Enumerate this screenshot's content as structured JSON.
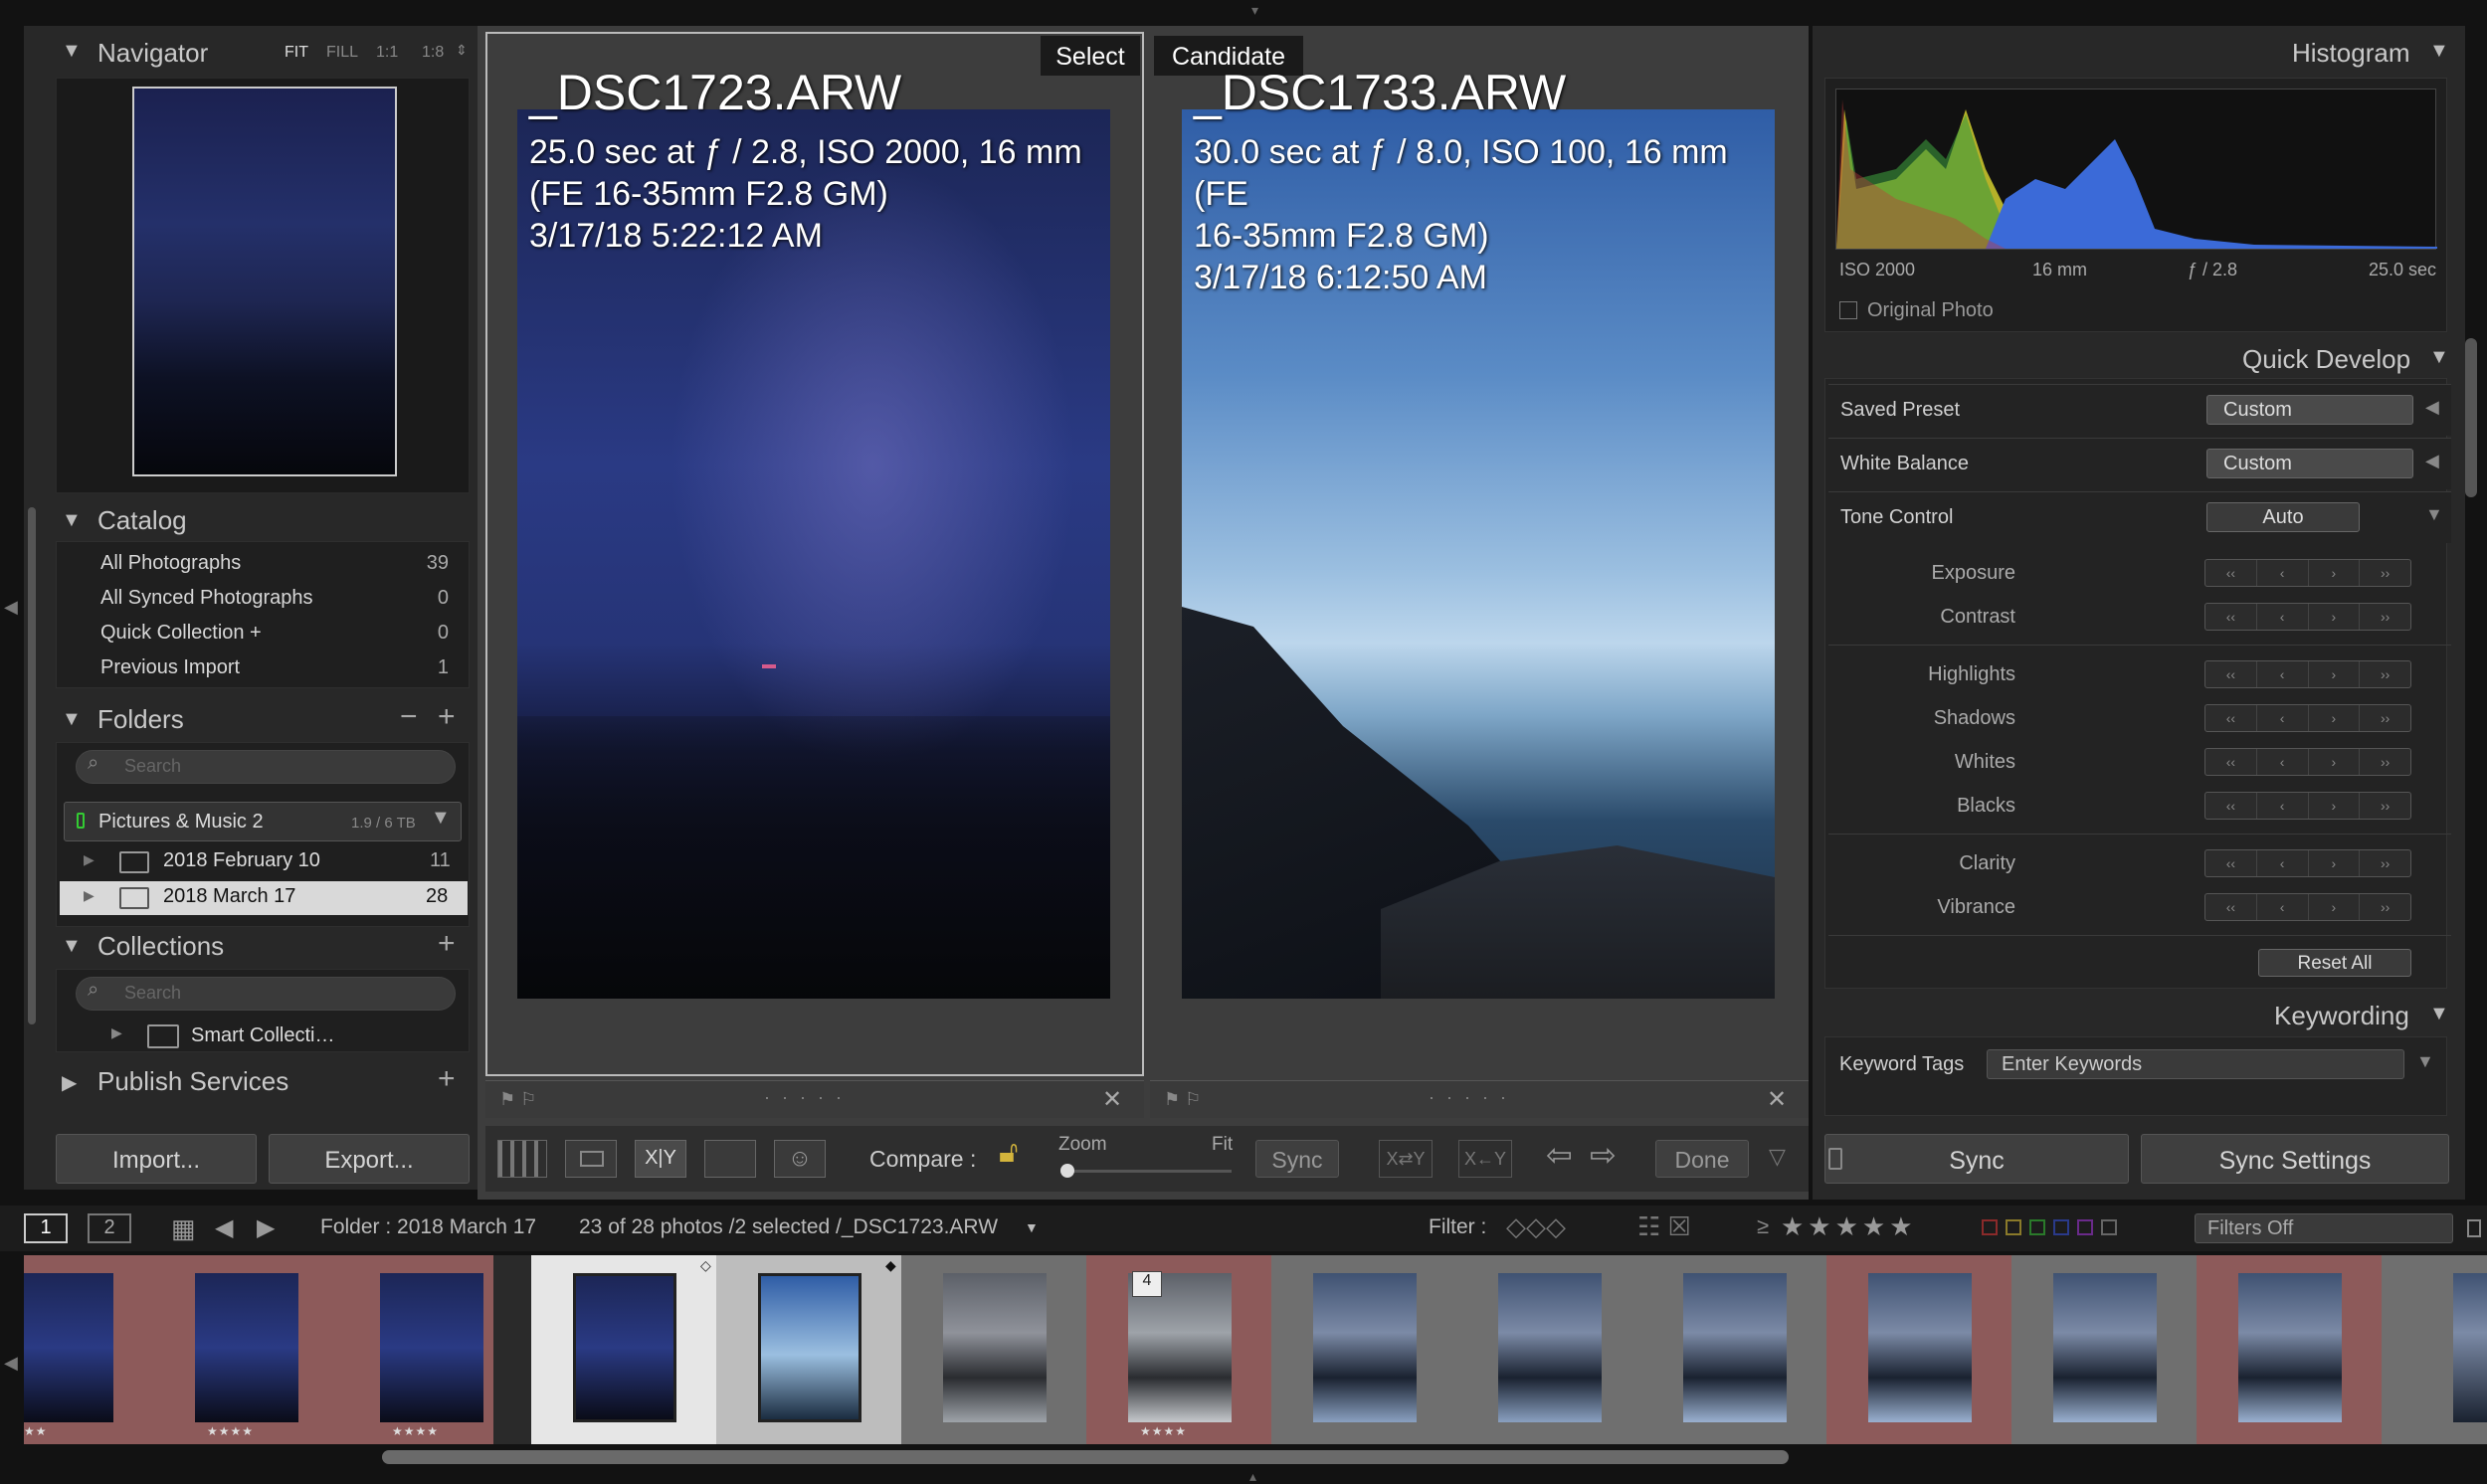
{
  "navigator": {
    "title": "Navigator",
    "zoom": [
      "FIT",
      "FILL",
      "1:1",
      "1:8"
    ]
  },
  "catalog": {
    "title": "Catalog",
    "items": [
      {
        "label": "All Photographs",
        "count": "39"
      },
      {
        "label": "All Synced Photographs",
        "count": "0"
      },
      {
        "label": "Quick Collection  +",
        "count": "0"
      },
      {
        "label": "Previous Import",
        "count": "1"
      }
    ]
  },
  "folders": {
    "title": "Folders",
    "search_placeholder": "Search",
    "volume": "Pictures & Music 2",
    "volume_size": "1.9 / 6 TB",
    "items": [
      {
        "label": "2018 February 10",
        "count": "11"
      },
      {
        "label": "2018 March 17",
        "count": "28"
      }
    ]
  },
  "collections": {
    "title": "Collections",
    "search_placeholder": "Search",
    "smart": "Smart Collecti…"
  },
  "publish": {
    "title": "Publish Services"
  },
  "buttons": {
    "import": "Import...",
    "export": "Export..."
  },
  "compare": {
    "select_label": "Select",
    "candidate_label": "Candidate",
    "left": {
      "file": "_DSC1723.ARW",
      "info": "25.0 sec at ƒ / 2.8, ISO 2000, 16 mm\n(FE 16-35mm F2.8 GM)\n3/17/18 5:22:12 AM"
    },
    "right": {
      "file": "_DSC1733.ARW",
      "info": "30.0 sec at ƒ / 8.0, ISO 100, 16 mm (FE\n16-35mm F2.8 GM)\n3/17/18 6:12:50 AM"
    }
  },
  "toolbar": {
    "compare": "Compare :",
    "zoom": "Zoom",
    "fit": "Fit",
    "sync": "Sync",
    "done": "Done",
    "xy": "X|Y"
  },
  "histogram": {
    "title": "Histogram",
    "iso": "ISO 2000",
    "focal": "16 mm",
    "aperture": "ƒ / 2.8",
    "shutter": "25.0 sec",
    "original": "Original Photo"
  },
  "quick_develop": {
    "title": "Quick Develop",
    "saved_preset": "Saved Preset",
    "saved_preset_value": "Custom",
    "white_balance": "White Balance",
    "white_balance_value": "Custom",
    "tone_control": "Tone Control",
    "auto": "Auto",
    "sliders": [
      "Exposure",
      "Contrast",
      "Highlights",
      "Shadows",
      "Whites",
      "Blacks",
      "Clarity",
      "Vibrance"
    ],
    "reset": "Reset All"
  },
  "keywording": {
    "title": "Keywording",
    "tags_label": "Keyword Tags",
    "tags_value": "Enter Keywords"
  },
  "right_buttons": {
    "sync": "Sync",
    "sync_settings": "Sync Settings"
  },
  "filmbar": {
    "view1": "1",
    "view2": "2",
    "folder": "Folder : 2018 March 17",
    "count": "23 of 28 photos /2 selected /_DSC1723.ARW",
    "filter": "Filter :",
    "filters_off": "Filters Off",
    "ge": "≥",
    "stars": "★★★★★"
  },
  "film_badge": "4",
  "colors": {
    "accent_reject": "#8d5a5a",
    "select_bg": "#e6e6e6",
    "panel": "#282828"
  }
}
